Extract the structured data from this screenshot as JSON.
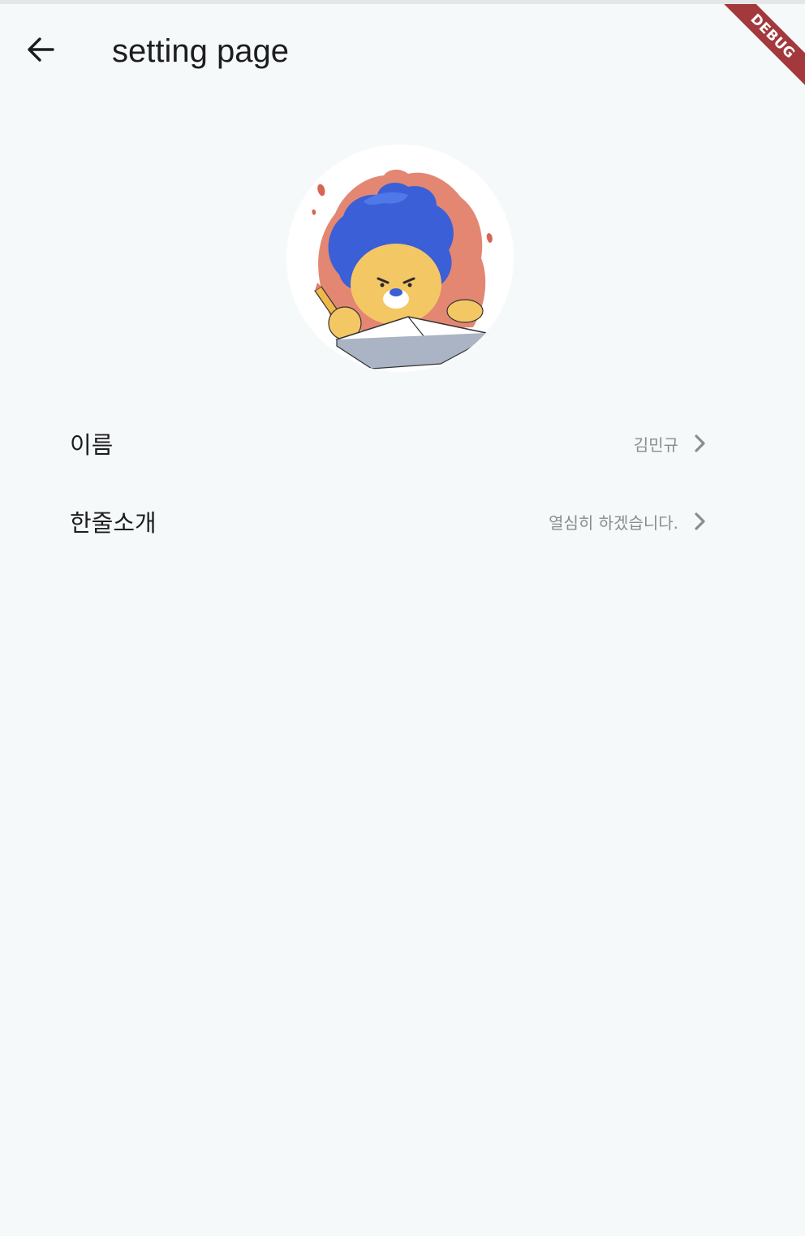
{
  "app_bar": {
    "title": "setting page",
    "back_icon": "arrow-back-icon"
  },
  "debug_banner": {
    "label": "DEBUG",
    "color": "#a3393d"
  },
  "profile": {
    "avatar_icon": "lion-character-avatar"
  },
  "settings": {
    "items": [
      {
        "label": "이름",
        "value": "김민규",
        "icon": "chevron-right-icon"
      },
      {
        "label": "한줄소개",
        "value": "열심히 하겠습니다.",
        "icon": "chevron-right-icon"
      }
    ]
  },
  "colors": {
    "background": "#f6f9fa",
    "text_primary": "#1c1d1f",
    "text_secondary": "#8a8c8e"
  }
}
